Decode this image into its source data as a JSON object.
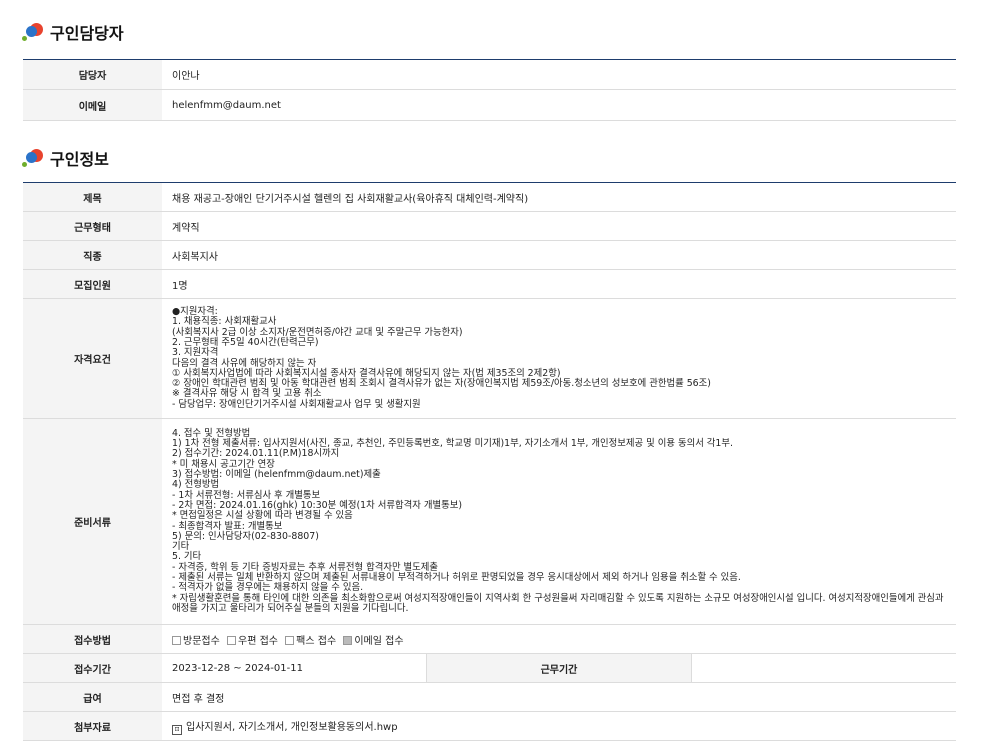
{
  "manager_section": {
    "title": "구인담당자",
    "rows": [
      {
        "label": "담당자",
        "value": "이안나"
      },
      {
        "label": "이메일",
        "value": "helenfmm@daum.net"
      }
    ]
  },
  "job_section": {
    "title": "구인정보",
    "rows": [
      {
        "label": "제목",
        "value": "채용 재공고-장애인 단기거주시설 헬렌의 집 사회재활교사(육아휴직 대체인력-계약직)"
      },
      {
        "label": "근무형태",
        "value": "계약직"
      },
      {
        "label": "직종",
        "value": "사회복지사"
      },
      {
        "label": "모집인원",
        "value": "1명"
      },
      {
        "label": "자격요건",
        "value": "●지원자격:\n1. 채용직종: 사회재활교사\n      (사회복지사 2급 이상 소지자/운전면허증/야간 교대 및 주말근무 가능한자)\n2. 근무형태 주5일 40시간(탄력근무)\n3. 지원자격\n다음의 결격 사유에 해당하지 않는 자\n① 사회복지사업법에 따라 사회복지시설 종사자 결격사유에 해당되지 않는 자(법 제35조의 2제2항)\n② 장애인 학대관련 범죄 및 아동 학대관련 범죄 조회시 결격사유가 없는 자(장애인복지법 제59조/아동.청소년의 성보호에 관한법률 56조)\n※ 결격사유 해당 시 합격 및 고용 취소\n- 담당업무: 장애인단기거주시설 사회재활교사 업무 및 생활지원"
      },
      {
        "label": "준비서류",
        "value": "4. 접수 및 전형방법\n1) 1차 전형 제출서류: 입사지원서(사진, 종교, 추천인, 주민등록번호, 학교명 미기재)1부, 자기소개서 1부, 개인정보제공 및 이용 동의서 각1부.\n2) 접수기간: 2024.01.11(P.M)18시까지\n* 미 채용시 공고기간 연장\n3) 접수방법: 이메일 (helenfmm@daum.net)제출\n4) 전형방법\n- 1차 서류전형: 서류심사 후 개별통보\n- 2차 면접: 2024.01.16(ghk) 10:30분 예정(1차 서류합격자 개별통보)\n* 면접일정은 시설 상황에 따라 변경될 수 있음\n- 최종합격자 발표: 개별통보\n5) 문의: 인사담당자(02-830-8807)\n기타\n5. 기타\n- 자격증, 학위 등 기타 증빙자료는 추후 서류전형 합격자만 별도제출\n- 제출된 서류는 일체 반환하지 않으며 제출된 서류내용이 부적격하거나 허위로 판명되었을 경우 응시대상에서 제외 하거나 임용을 취소할 수 있음.\n- 적격자가 없을 경우에는 채용하지 않을 수 있음.\n* 자립생활훈련을 통해 타인에 대한 의존을 최소화함으로써 여성지적장애인들이 지역사회 한 구성원을써 자리매김할 수 있도록 지원하는 소규모 여성장애인시설 입니다. 여성지적장애인들에게 관심과 애정을 가지고 울타리가 되어주실 분들의 지원을 기다립니다."
      }
    ],
    "receipt": {
      "label": "접수방법",
      "methods": [
        {
          "name": "방문접수",
          "checked": false
        },
        {
          "name": "우편 접수",
          "checked": false
        },
        {
          "name": "팩스 접수",
          "checked": false
        },
        {
          "name": "이메일 접수",
          "checked": true
        }
      ]
    },
    "period": {
      "label": "접수기간",
      "value": "2023-12-28 ~ 2024-01-11",
      "work_label": "근무기간",
      "work_value": ""
    },
    "salary": {
      "label": "급여",
      "value": "면접 후 결정"
    },
    "attachment": {
      "label": "첨부자료",
      "value": "입사지원서, 자기소개서, 개인정보활용동의서.hwp"
    }
  }
}
